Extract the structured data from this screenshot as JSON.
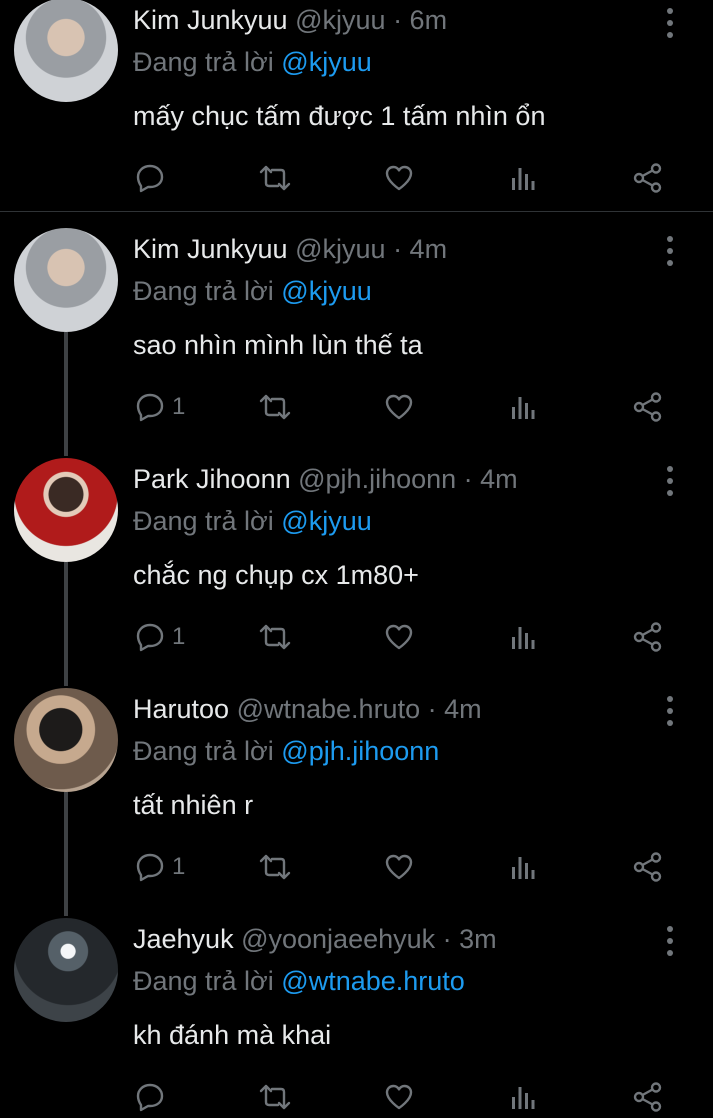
{
  "reply_prefix": "Đang trả lời",
  "colors": {
    "background": "#000000",
    "text": "#e7e9ea",
    "muted": "#71767b",
    "mention": "#1d9bf0",
    "thread_line": "#3e4144"
  },
  "icons": [
    "reply-icon",
    "retweet-icon",
    "like-icon",
    "views-icon",
    "share-icon",
    "more-icon"
  ],
  "tweets": [
    {
      "name": "Kim Junkyuu",
      "handle": "@kjyuu",
      "time": "· 6m",
      "reply_to": "@kjyuu",
      "text": "mấy chục tấm được 1 tấm nhìn ổn",
      "reply_count": ""
    },
    {
      "name": "Kim Junkyuu",
      "handle": "@kjyuu",
      "time": "· 4m",
      "reply_to": "@kjyuu",
      "text": "sao nhìn mình lùn thế ta",
      "reply_count": "1"
    },
    {
      "name": "Park Jihoonn",
      "handle": "@pjh.jihoonn",
      "time": "· 4m",
      "reply_to": "@kjyuu",
      "text": "chắc ng chụp cx 1m80+",
      "reply_count": "1"
    },
    {
      "name": "Harutoo",
      "handle": "@wtnabe.hruto",
      "time": "· 4m",
      "reply_to": "@pjh.jihoonn",
      "text": "tất nhiên r",
      "reply_count": "1"
    },
    {
      "name": "Jaehyuk",
      "handle": "@yoonjaeehyuk",
      "time": "· 3m",
      "reply_to": "@wtnabe.hruto",
      "text": "kh đánh mà khai",
      "reply_count": ""
    }
  ]
}
